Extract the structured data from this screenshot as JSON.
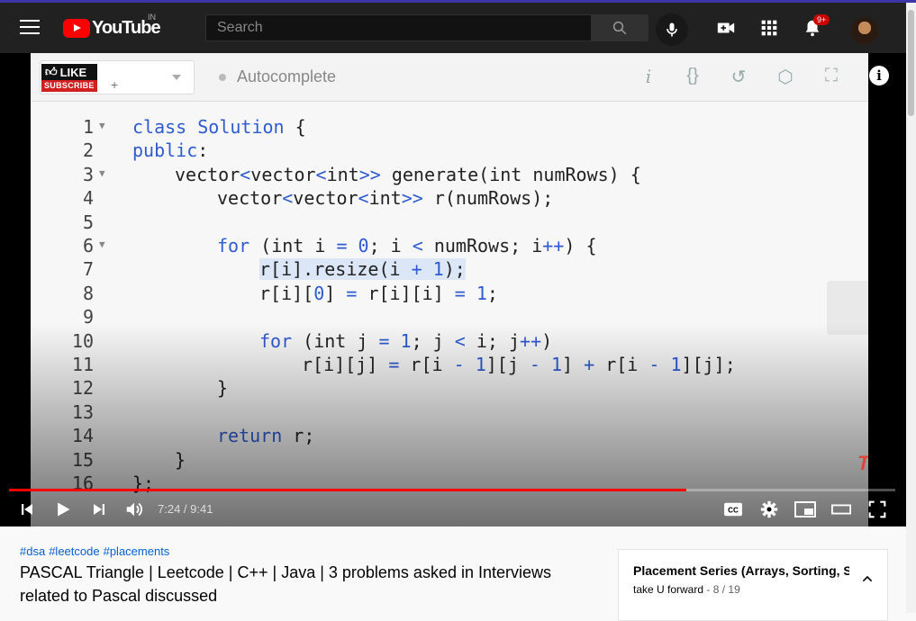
{
  "masthead": {
    "logo_text": "YouTube",
    "region": "IN",
    "search_placeholder": "Search",
    "notification_count": "9+"
  },
  "editor": {
    "like_badge_top": "LIKE",
    "like_badge_bottom": "SUBSCRIBE",
    "lang_plus": "+",
    "autocomplete_label": "Autocomplete",
    "toolbar_icons": [
      "info-italic-icon",
      "braces-icon",
      "undo-icon",
      "settings-hex-icon",
      "fullscreen-icon"
    ],
    "watermark": "TUF",
    "lines": [
      {
        "n": "1",
        "fold": true,
        "indent": 0,
        "html": "<span class='kw'>class Solution</span> {"
      },
      {
        "n": "2",
        "fold": false,
        "indent": 0,
        "html": "<span class='kw'>public</span>:"
      },
      {
        "n": "3",
        "fold": true,
        "indent": 1,
        "html": "vector<span class='kw'>&lt;</span>vector<span class='kw'>&lt;</span>int<span class='kw'>&gt;&gt;</span> generate(int numRows) {"
      },
      {
        "n": "4",
        "fold": false,
        "indent": 2,
        "html": "vector<span class='kw'>&lt;</span>vector<span class='kw'>&lt;</span>int<span class='kw'>&gt;&gt;</span> r(numRows);"
      },
      {
        "n": "5",
        "fold": false,
        "indent": 0,
        "html": ""
      },
      {
        "n": "6",
        "fold": true,
        "indent": 2,
        "html": "<span class='kw'>for</span> (int i <span class='kw'>=</span> <span class='kw'>0</span>; i <span class='kw'>&lt;</span> numRows; i<span class='kw'>++</span>) {"
      },
      {
        "n": "7",
        "fold": false,
        "indent": 3,
        "html": "<span class='hl'>r[i].resize(i <span class='kw'>+</span> <span class='kw'>1</span>);</span>"
      },
      {
        "n": "8",
        "fold": false,
        "indent": 3,
        "html": "r[i][<span class='kw'>0</span>] <span class='kw'>=</span> r[i][i] <span class='kw'>=</span> <span class='kw'>1</span>;"
      },
      {
        "n": "9",
        "fold": false,
        "indent": 0,
        "html": ""
      },
      {
        "n": "10",
        "fold": false,
        "indent": 3,
        "html": "<span class='kw'>for</span> (int j <span class='kw'>=</span> <span class='kw'>1</span>; j <span class='kw'>&lt;</span> i; j<span class='kw'>++</span>)"
      },
      {
        "n": "11",
        "fold": false,
        "indent": 4,
        "html": "r[i][j] <span class='kw'>=</span> r[i <span class='kw'>-</span> <span class='kw'>1</span>][j <span class='kw'>-</span> <span class='kw'>1</span>] <span class='kw'>+</span> r[i <span class='kw'>-</span> <span class='kw'>1</span>][j];"
      },
      {
        "n": "12",
        "fold": false,
        "indent": 2,
        "html": "}"
      },
      {
        "n": "13",
        "fold": false,
        "indent": 0,
        "html": ""
      },
      {
        "n": "14",
        "fold": false,
        "indent": 2,
        "html": "<span class='kw'>return</span> r;"
      },
      {
        "n": "15",
        "fold": false,
        "indent": 1,
        "html": "}"
      },
      {
        "n": "16",
        "fold": false,
        "indent": 0,
        "html": "};"
      }
    ]
  },
  "player": {
    "current_time": "7:24",
    "duration": "9:41",
    "time_display": "7:24 / 9:41",
    "progress_fraction": 0.7643
  },
  "video": {
    "hashtags": [
      "#dsa",
      "#leetcode",
      "#placements"
    ],
    "title": "PASCAL Triangle | Leetcode | C++ | Java | 3 problems asked in Interviews related to Pascal discussed"
  },
  "playlist": {
    "title": "Placement Series (Arrays, Sorting, Se",
    "channel": "take U forward",
    "position": "8 / 19"
  }
}
